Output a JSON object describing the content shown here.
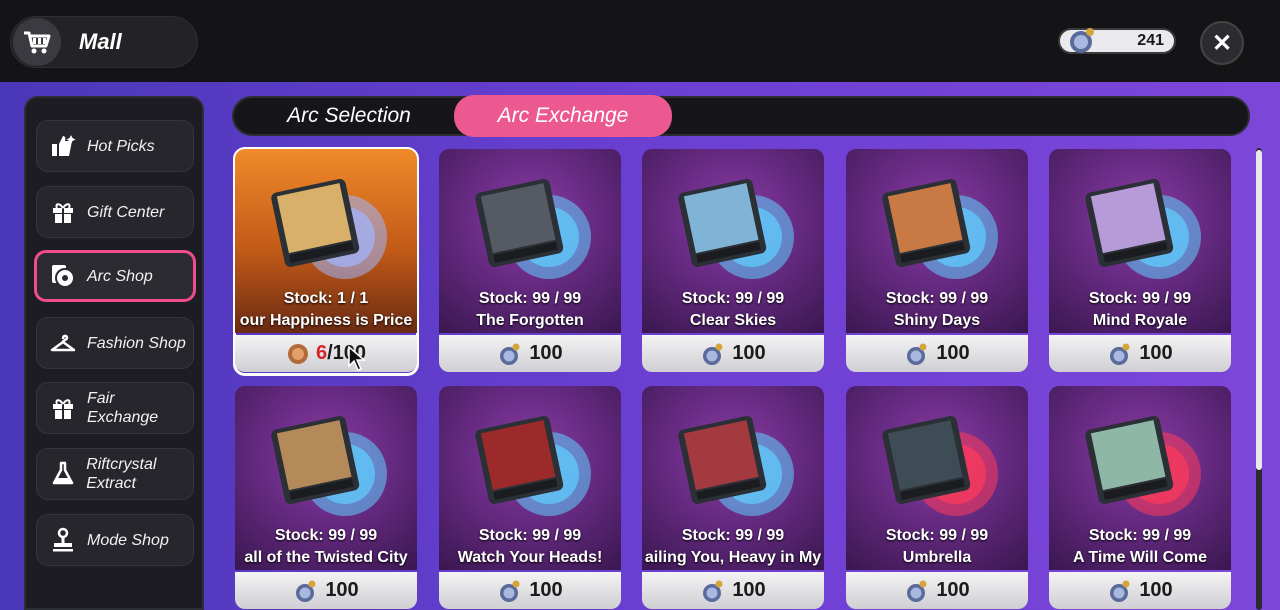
{
  "header": {
    "title": "Mall",
    "currency_amount": "241"
  },
  "sidebar": {
    "items": [
      {
        "label": "Hot Picks",
        "icon": "hot-picks-icon"
      },
      {
        "label": "Gift Center",
        "icon": "gift-icon"
      },
      {
        "label": "Arc Shop",
        "icon": "arc-icon",
        "active": true
      },
      {
        "label": "Fashion Shop",
        "icon": "hanger-icon"
      },
      {
        "label": "Fair Exchange",
        "icon": "gift-icon"
      },
      {
        "label": "Riftcrystal Extract",
        "icon": "flask-icon"
      },
      {
        "label": "Mode Shop",
        "icon": "stamp-icon"
      }
    ]
  },
  "tabs": [
    {
      "label": "Arc Selection"
    },
    {
      "label": "Arc Exchange",
      "active": true
    }
  ],
  "items": [
    {
      "stock": "Stock:  1 / 1",
      "name": "our Happiness is Price",
      "price_current": "6",
      "price_total": "/100",
      "theme": "gold",
      "art": "#d8b06a"
    },
    {
      "stock": "Stock:  99 / 99",
      "name": "The Forgotten",
      "price": "100",
      "art": "#555a63"
    },
    {
      "stock": "Stock:  99 / 99",
      "name": "Clear Skies",
      "price": "100",
      "art": "#7fb4d6"
    },
    {
      "stock": "Stock:  99 / 99",
      "name": "Shiny Days",
      "price": "100",
      "art": "#c97a44"
    },
    {
      "stock": "Stock:  99 / 99",
      "name": "Mind Royale",
      "price": "100",
      "art": "#b79ad8"
    },
    {
      "stock": "Stock:  99 / 99",
      "name": "all of the Twisted City",
      "price": "100",
      "art": "#b58a5a"
    },
    {
      "stock": "Stock:  99 / 99",
      "name": "Watch Your Heads!",
      "price": "100",
      "art": "#9c2a2a"
    },
    {
      "stock": "Stock:  99 / 99",
      "name": "ailing You, Heavy in My",
      "price": "100",
      "art": "#a33a3f"
    },
    {
      "stock": "Stock:  99 / 99",
      "name": "Umbrella",
      "price": "100",
      "art": "#3e4c55"
    },
    {
      "stock": "Stock:  99 / 99",
      "name": "A Time Will Come",
      "price": "100",
      "art": "#8fb7a8"
    }
  ],
  "colors": {
    "accent": "#ec5990",
    "active_border": "#f14d8e"
  }
}
